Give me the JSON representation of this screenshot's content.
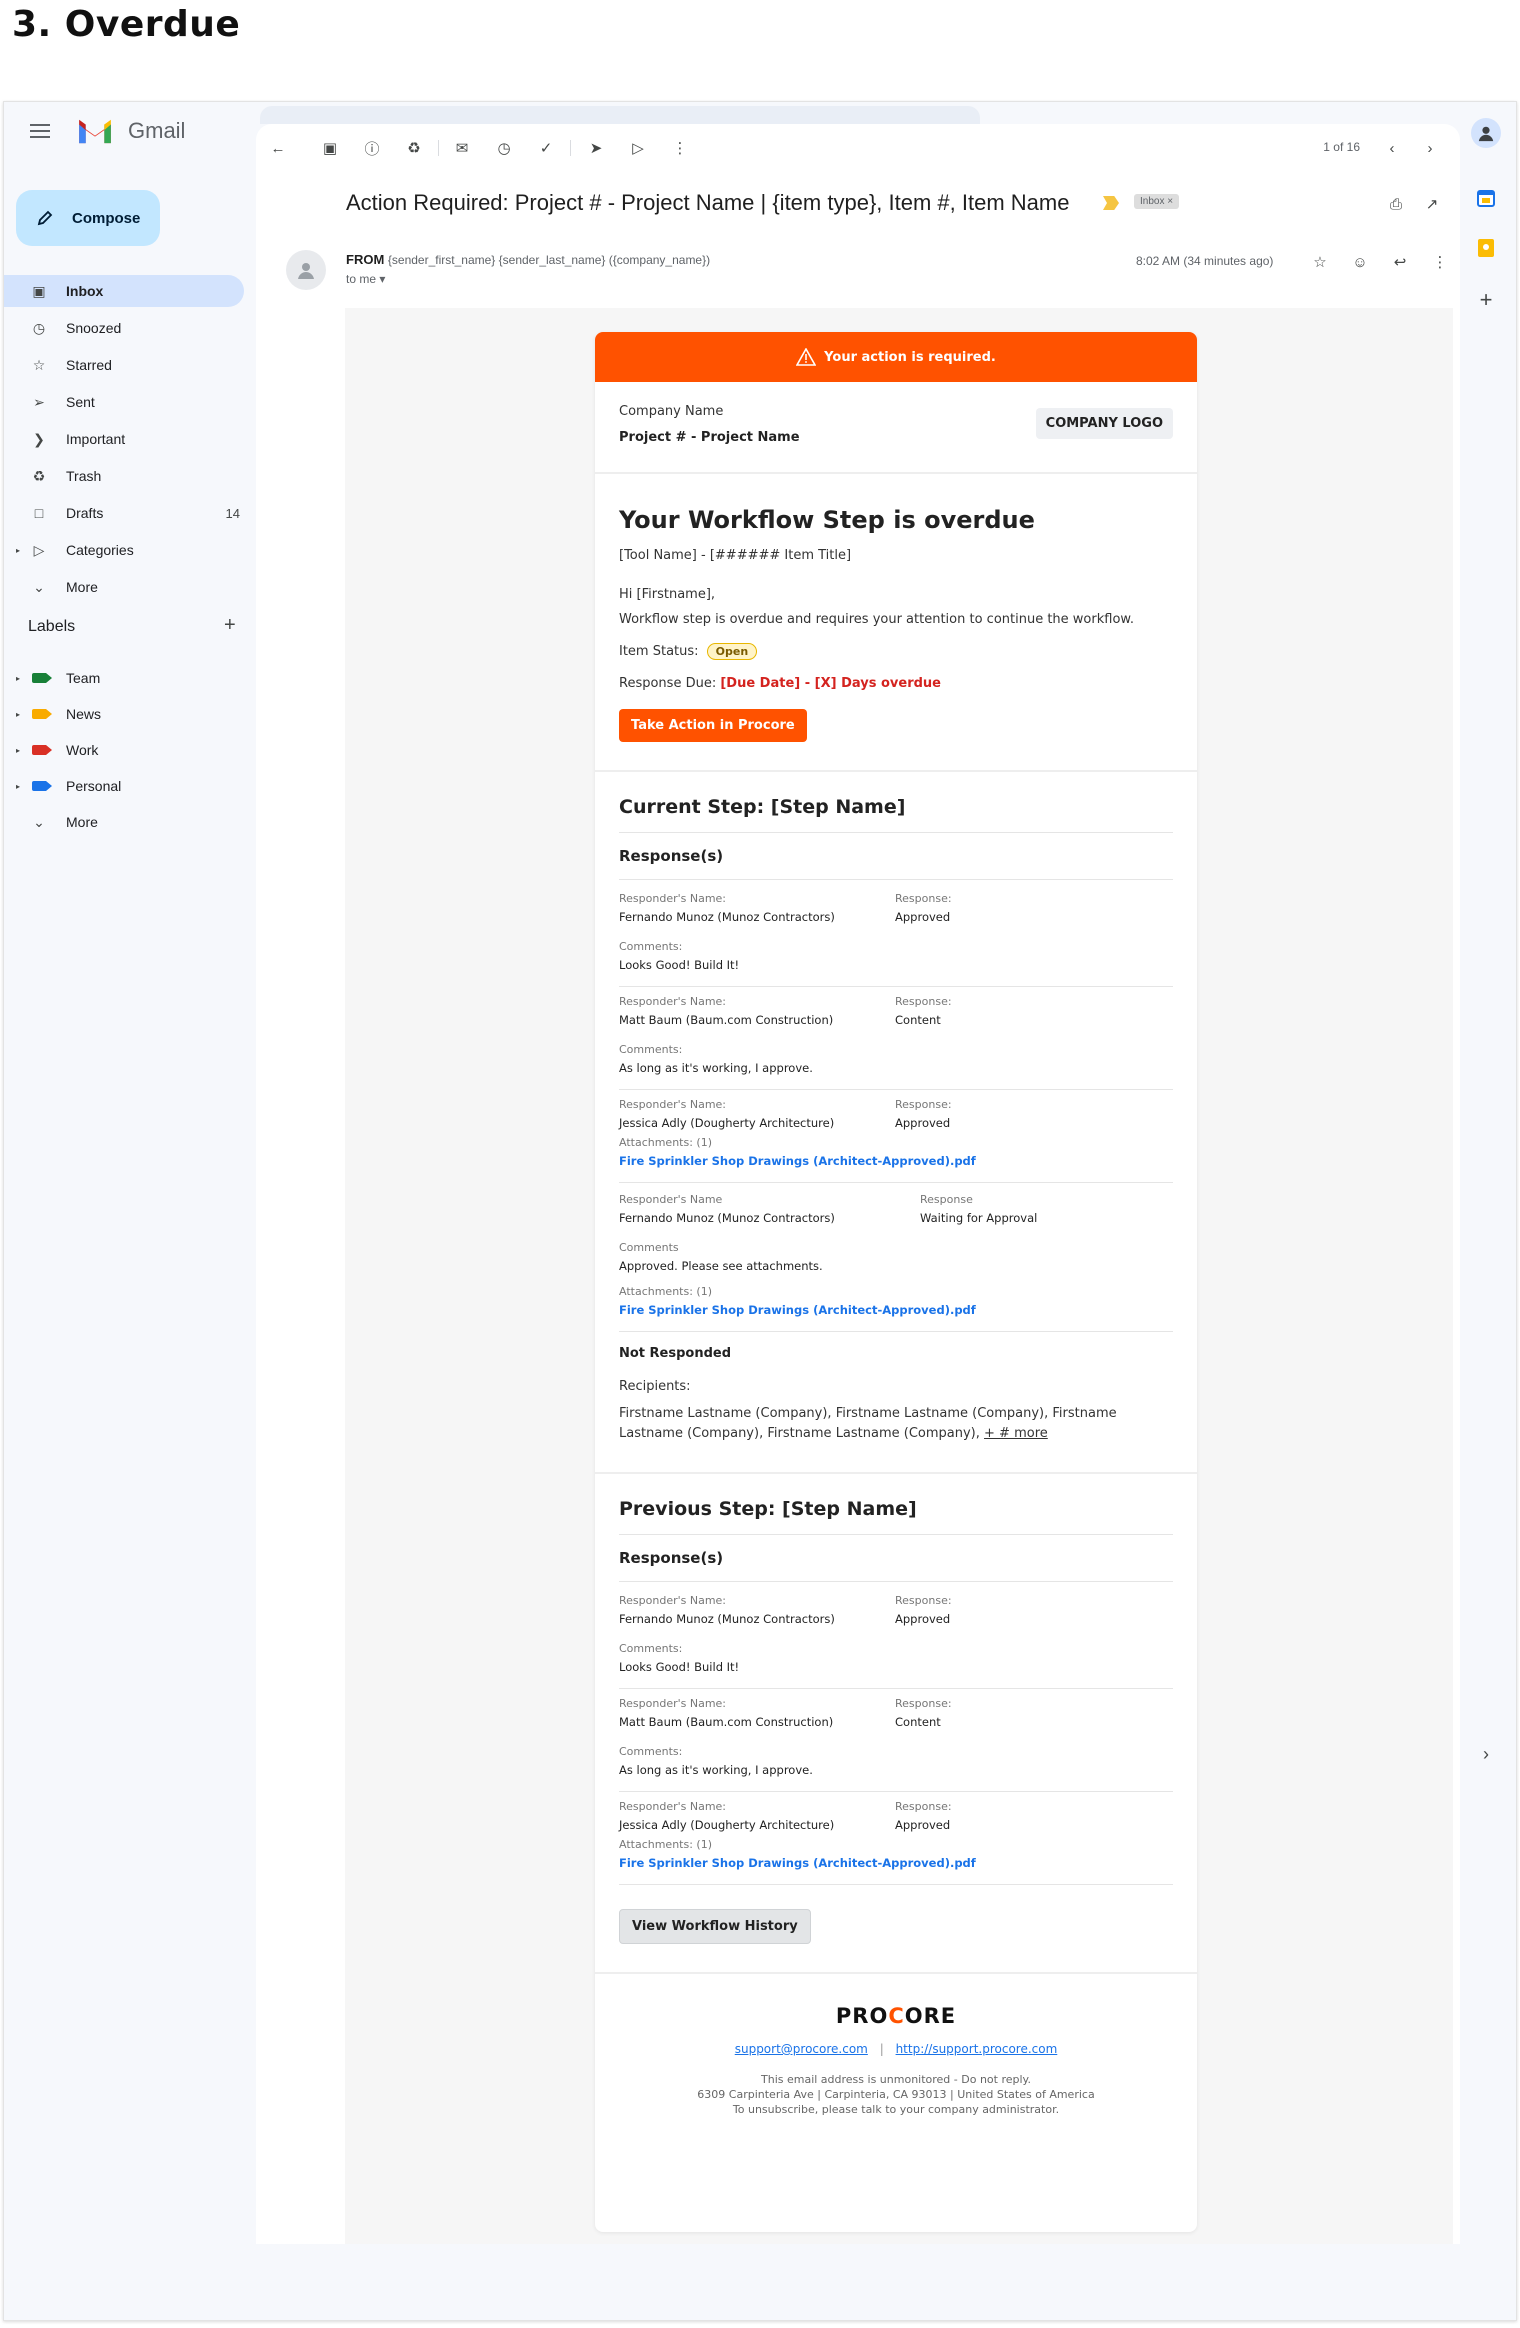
{
  "page_heading": "3. Overdue",
  "gmail": {
    "wordmark": "Gmail",
    "compose": "Compose",
    "nav": [
      {
        "label": "Inbox",
        "icon": "inbox-icon",
        "count": ""
      },
      {
        "label": "Snoozed",
        "icon": "clock-icon",
        "count": ""
      },
      {
        "label": "Starred",
        "icon": "star-icon",
        "count": ""
      },
      {
        "label": "Sent",
        "icon": "send-icon",
        "count": ""
      },
      {
        "label": "Important",
        "icon": "important-icon",
        "count": ""
      },
      {
        "label": "Trash",
        "icon": "trash-icon",
        "count": ""
      },
      {
        "label": "Drafts",
        "icon": "draft-icon",
        "count": "14"
      },
      {
        "label": "Categories",
        "icon": "label-icon",
        "count": ""
      },
      {
        "label": "More",
        "icon": "chevron-down-icon",
        "count": ""
      }
    ],
    "labels_heading": "Labels",
    "labels": [
      {
        "label": "Team",
        "color": "#188038"
      },
      {
        "label": "News",
        "color": "#f9ab00"
      },
      {
        "label": "Work",
        "color": "#d93025"
      },
      {
        "label": "Personal",
        "color": "#1a73e8"
      }
    ],
    "labels_more": "More",
    "pager": "1 of 16",
    "subject": "Action Required: Project # - Project Name | {item type}, Item #, Item Name",
    "inbox_chip": "Inbox",
    "from_label": "FROM",
    "from_detail": "{sender_first_name} {sender_last_name} ({company_name})",
    "to_me": "to me",
    "timestamp": "8:02 AM (34 minutes ago)"
  },
  "email": {
    "banner": "Your action is required.",
    "company_name": "Company Name",
    "project_name": "Project # - Project Name",
    "company_logo": "COMPANY LOGO",
    "title": "Your Workflow Step is overdue",
    "tool_line": "[Tool Name] - [###### Item Title]",
    "greeting": "Hi [Firstname],",
    "message": "Workflow step is overdue and requires your attention to continue the workflow.",
    "status_label": "Item Status:",
    "status_value": "Open",
    "due_label": "Response Due:",
    "due_value": "[Due Date] - [X] Days overdue",
    "cta": "Take Action in Procore",
    "current_step": "Current Step: [Step Name]",
    "responses_heading": "Response(s)",
    "current_responses": [
      {
        "name_label": "Responder's Name:",
        "name": "Fernando Munoz (Munoz Contractors)",
        "resp_label": "Response:",
        "resp": "Approved",
        "extra_label": "Comments:",
        "extra": "Looks Good! Build It!",
        "is_link": false
      },
      {
        "name_label": "Responder's Name:",
        "name": "Matt Baum (Baum.com Construction)",
        "resp_label": "Response:",
        "resp": "Content",
        "extra_label": "Comments:",
        "extra": "As long as it's working, I approve.",
        "is_link": false
      },
      {
        "name_label": "Responder's Name:",
        "name": "Jessica Adly (Dougherty Architecture)",
        "resp_label": "Response:",
        "resp": "Approved",
        "extra_label": "Attachments: (1)",
        "extra": "Fire Sprinkler Shop Drawings (Architect-Approved).pdf",
        "is_link": true
      }
    ],
    "pending": {
      "name_label": "Responder's Name",
      "name": "Fernando Munoz (Munoz Contractors)",
      "resp_label": "Response",
      "resp": "Waiting for Approval",
      "comments_label": "Comments",
      "comments": "Approved. Please see attachments.",
      "attach_label": "Attachments: (1)",
      "attach": "Fire Sprinkler Shop Drawings (Architect-Approved).pdf"
    },
    "not_responded": "Not Responded",
    "recipients_label": "Recipients:",
    "recipients": "Firstname Lastname (Company), Firstname Lastname (Company), Firstname Lastname (Company), Firstname Lastname (Company),",
    "more_link": "+ # more",
    "previous_step": "Previous Step: [Step Name]",
    "previous_responses": [
      {
        "name_label": "Responder's Name:",
        "name": "Fernando Munoz (Munoz Contractors)",
        "resp_label": "Response:",
        "resp": "Approved",
        "extra_label": "Comments:",
        "extra": "Looks Good! Build It!",
        "is_link": false
      },
      {
        "name_label": "Responder's Name:",
        "name": "Matt Baum (Baum.com Construction)",
        "resp_label": "Response:",
        "resp": "Content",
        "extra_label": "Comments:",
        "extra": "As long as it's working, I approve.",
        "is_link": false
      },
      {
        "name_label": "Responder's Name:",
        "name": "Jessica Adly (Dougherty Architecture)",
        "resp_label": "Response:",
        "resp": "Approved",
        "extra_label": "Attachments: (1)",
        "extra": "Fire Sprinkler Shop Drawings (Architect-Approved).pdf",
        "is_link": true
      }
    ],
    "history_button": "View Workflow History",
    "footer_logo": "PROCORE",
    "support_email": "support@procore.com",
    "support_url": "http://support.procore.com",
    "footer_line1": "This email address is unmonitored - Do not reply.",
    "footer_line2": "6309 Carpinteria Ave | Carpinteria, CA 93013 | United States of America",
    "footer_line3": "To unsubscribe, please talk to your company administrator."
  },
  "colors": {
    "procore_orange": "#ff5200",
    "gmail_active": "#d3e3fd",
    "compose_bg": "#c2e7ff"
  }
}
